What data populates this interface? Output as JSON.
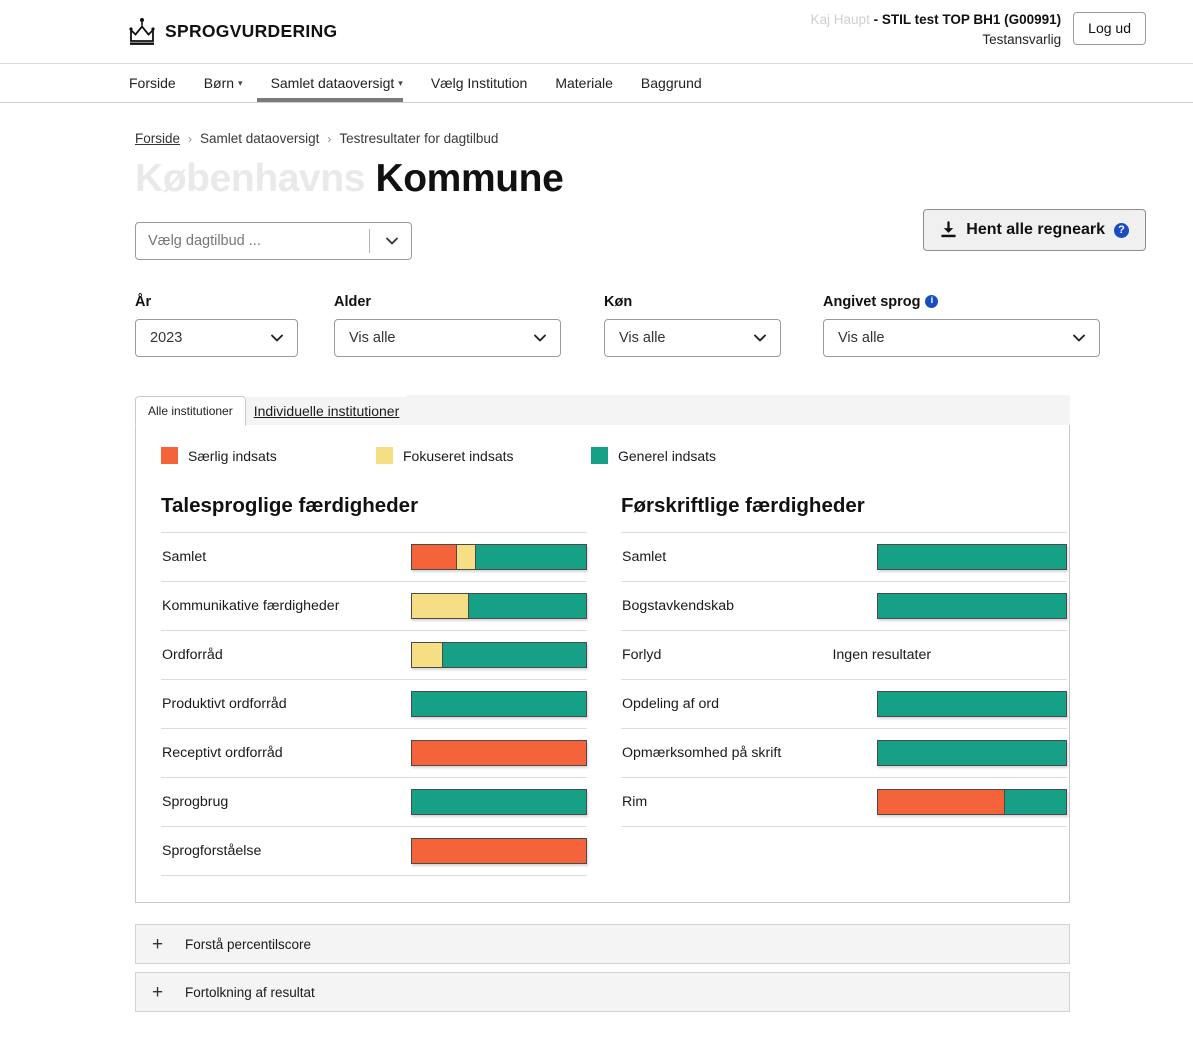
{
  "header": {
    "brand": "SPROGVURDERING",
    "brand_icon": "crown-icon",
    "user_name": "Kaj Haupt",
    "user_org": "- STIL test TOP BH1 (G00991)",
    "user_role": "Testansvarlig",
    "logout_label": "Log ud"
  },
  "nav": {
    "items": [
      {
        "label": "Forside",
        "has_caret": false,
        "active": false
      },
      {
        "label": "Børn",
        "has_caret": true,
        "active": false
      },
      {
        "label": "Samlet dataoversigt",
        "has_caret": true,
        "active": true
      },
      {
        "label": "Vælg Institution",
        "has_caret": false,
        "active": false
      },
      {
        "label": "Materiale",
        "has_caret": false,
        "active": false
      },
      {
        "label": "Baggrund",
        "has_caret": false,
        "active": false
      }
    ]
  },
  "breadcrumb": {
    "items": [
      "Forside",
      "Samlet dataoversigt",
      "Testresultater for dagtilbud"
    ],
    "separator": "›"
  },
  "title": {
    "muted": "Københavns",
    "main": "Kommune"
  },
  "dagtilbud_select": {
    "placeholder": "Vælg dagtilbud ...",
    "value": ""
  },
  "download": {
    "label": "Hent alle regneark",
    "icon": "download-icon",
    "help_glyph": "?"
  },
  "filters": [
    {
      "label": "År",
      "value": "2023",
      "has_info": false
    },
    {
      "label": "Alder",
      "value": "Vis alle",
      "has_info": false
    },
    {
      "label": "Køn",
      "value": "Vis alle",
      "has_info": false
    },
    {
      "label": "Angivet sprog",
      "value": "Vis alle",
      "has_info": true,
      "info_glyph": "i"
    }
  ],
  "tabs": [
    {
      "label": "Alle institutioner",
      "active": true
    },
    {
      "label": "Individuelle institutioner",
      "active": false
    }
  ],
  "colors": {
    "saerlig": "#F4633A",
    "fokuseret": "#F5DE84",
    "generel": "#16A186",
    "accent_blue": "#1A4CC4",
    "title_muted": "#E9E9E9"
  },
  "legend": [
    {
      "label": "Særlig indsats",
      "color": "#F4633A"
    },
    {
      "label": "Fokuseret indsats",
      "color": "#F5DE84"
    },
    {
      "label": "Generel indsats",
      "color": "#16A186"
    }
  ],
  "chart_data": {
    "type": "bar",
    "title": "Testresultater for dagtilbud",
    "orientation": "horizontal-stacked-100",
    "series": [
      {
        "name": "Særlig indsats",
        "color": "#F4633A"
      },
      {
        "name": "Fokuseret indsats",
        "color": "#F5DE84"
      },
      {
        "name": "Generel indsats",
        "color": "#16A186"
      }
    ],
    "groups": [
      {
        "title": "Talesproglige færdigheder",
        "rows": [
          {
            "label": "Samlet",
            "values": [
              25,
              11,
              64
            ]
          },
          {
            "label": "Kommunikative færdigheder",
            "values": [
              0,
              32,
              68
            ]
          },
          {
            "label": "Ordforråd",
            "values": [
              0,
              17,
              83
            ]
          },
          {
            "label": "Produktivt ordforråd",
            "values": [
              0,
              0,
              100
            ]
          },
          {
            "label": "Receptivt ordforråd",
            "values": [
              100,
              0,
              0
            ]
          },
          {
            "label": "Sprogbrug",
            "values": [
              0,
              0,
              100
            ]
          },
          {
            "label": "Sprogforståelse",
            "values": [
              100,
              0,
              0
            ]
          }
        ]
      },
      {
        "title": "Førskriftlige færdigheder",
        "rows": [
          {
            "label": "Samlet",
            "values": [
              0,
              0,
              100
            ]
          },
          {
            "label": "Bogstavkendskab",
            "values": [
              0,
              0,
              100
            ]
          },
          {
            "label": "Forlyd",
            "values": null,
            "no_result_text": "Ingen resultater"
          },
          {
            "label": "Opdeling af ord",
            "values": [
              0,
              0,
              100
            ]
          },
          {
            "label": "Opmærksomhed på skrift",
            "values": [
              0,
              0,
              100
            ]
          },
          {
            "label": "Rim",
            "values": [
              67,
              0,
              33
            ]
          }
        ]
      }
    ],
    "xlabel": "",
    "ylabel": "",
    "xlim": [
      0,
      100
    ],
    "grid": false,
    "legend_position": "top"
  },
  "accordions": [
    {
      "label": "Forstå percentilscore",
      "icon": "plus-icon"
    },
    {
      "label": "Fortolkning af resultat",
      "icon": "plus-icon"
    }
  ]
}
